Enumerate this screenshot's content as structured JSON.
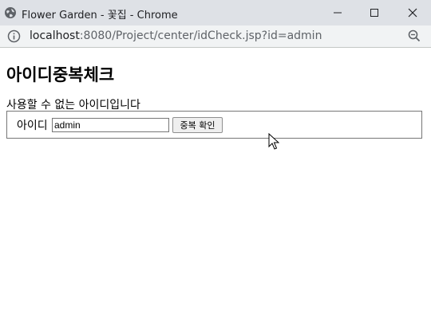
{
  "window": {
    "title": "Flower Garden - 꽃집 - Chrome",
    "app_icon": "globe-icon",
    "controls": [
      "minimize-icon",
      "maximize-icon",
      "close-icon"
    ]
  },
  "address_bar": {
    "host": "localhost",
    "path": ":8080/Project/center/idCheck.jsp?id=admin",
    "left_icon": "info-icon",
    "right_icon": "zoom-icon"
  },
  "page": {
    "heading": "아이디중복체크",
    "message": "사용할 수 없는 아이디입니다",
    "form": {
      "id_label": "아이디",
      "id_value": "admin",
      "check_button": "중복 확인"
    }
  },
  "colors": {
    "titlebar": "#dee1e6",
    "addressbar": "#f1f3f4",
    "border": "#767676"
  }
}
